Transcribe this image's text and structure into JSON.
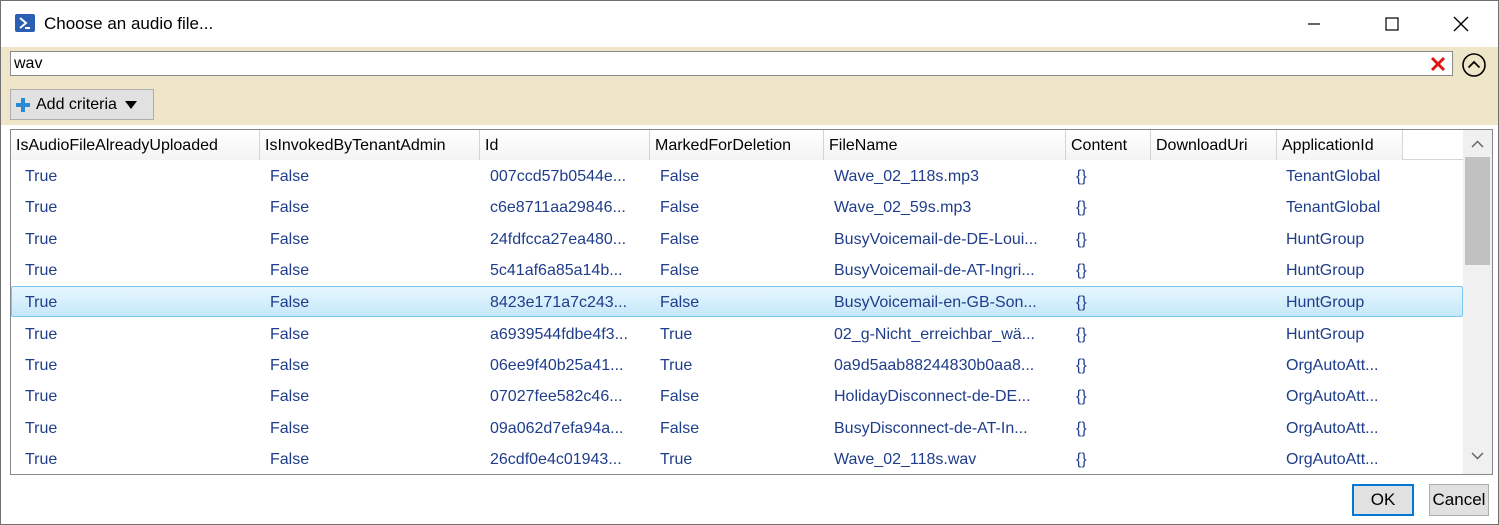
{
  "window": {
    "title": "Choose an audio file...",
    "icon": "powershell-icon"
  },
  "filter": {
    "query": "wav",
    "add_criteria_label": "Add criteria"
  },
  "grid": {
    "columns": [
      "IsAudioFileAlreadyUploaded",
      "IsInvokedByTenantAdmin",
      "Id",
      "MarkedForDeletion",
      "FileName",
      "Content",
      "DownloadUri",
      "ApplicationId"
    ],
    "selected_row": 4,
    "rows": [
      [
        "True",
        "False",
        "007ccd57b0544e...",
        "False",
        "Wave_02_118s.mp3",
        "{}",
        "",
        "TenantGlobal"
      ],
      [
        "True",
        "False",
        "c6e8711aa29846...",
        "False",
        "Wave_02_59s.mp3",
        "{}",
        "",
        "TenantGlobal"
      ],
      [
        "True",
        "False",
        "24fdfcca27ea480...",
        "False",
        "BusyVoicemail-de-DE-Loui...",
        "{}",
        "",
        "HuntGroup"
      ],
      [
        "True",
        "False",
        "5c41af6a85a14b...",
        "False",
        "BusyVoicemail-de-AT-Ingri...",
        "{}",
        "",
        "HuntGroup"
      ],
      [
        "True",
        "False",
        "8423e171a7c243...",
        "False",
        "BusyVoicemail-en-GB-Son...",
        "{}",
        "",
        "HuntGroup"
      ],
      [
        "True",
        "False",
        "a6939544fdbe4f3...",
        "True",
        "02_g-Nicht_erreichbar_wä...",
        "{}",
        "",
        "HuntGroup"
      ],
      [
        "True",
        "False",
        "06ee9f40b25a41...",
        "True",
        "0a9d5aab88244830b0aa8...",
        "{}",
        "",
        "OrgAutoAtt..."
      ],
      [
        "True",
        "False",
        "07027fee582c46...",
        "False",
        "HolidayDisconnect-de-DE...",
        "{}",
        "",
        "OrgAutoAtt..."
      ],
      [
        "True",
        "False",
        "09a062d7efa94a...",
        "False",
        "BusyDisconnect-de-AT-In...",
        "{}",
        "",
        "OrgAutoAtt..."
      ],
      [
        "True",
        "False",
        "26cdf0e4c01943...",
        "True",
        "Wave_02_118s.wav",
        "{}",
        "",
        "OrgAutoAtt..."
      ]
    ]
  },
  "buttons": {
    "ok": "OK",
    "cancel": "Cancel"
  },
  "colors": {
    "filter_background": "#efe6c9",
    "cell_text": "#1f3d8a",
    "selection": "#c4e8fa",
    "ok_border": "#0078d7"
  }
}
